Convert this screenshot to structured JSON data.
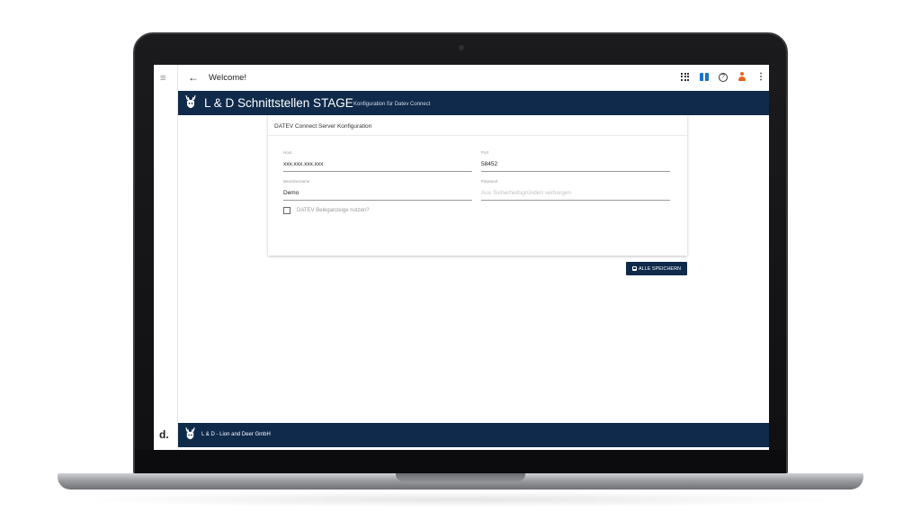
{
  "topbar": {
    "back_icon": "arrow-left-icon",
    "title": "Welcome!",
    "icons": [
      "apps-grid-icon",
      "gift-icon",
      "help-icon",
      "user-icon",
      "more-vert-icon"
    ]
  },
  "rail": {
    "menu_icon": "hamburger-menu-icon",
    "logo_text": "d."
  },
  "appbar": {
    "title": "L & D Schnittstellen STAGE",
    "subtitle": "Konfiguration für Datev Connect",
    "logo": "deer-logo-icon"
  },
  "card": {
    "title": "DATEV Connect Server Konfiguration",
    "host": {
      "label": "Host",
      "value": "xxx.xxx.xxx.xxx"
    },
    "port": {
      "label": "Port",
      "value": "58452"
    },
    "username": {
      "label": "Benutzername",
      "value": "Demo"
    },
    "password": {
      "label": "Passwort",
      "placeholder": "Aus Sicherheitsgründen verborgen"
    },
    "checkbox": {
      "label": "DATEV Beleganzeige nutzen?",
      "checked": false
    }
  },
  "actions": {
    "save_label": "ALLE SPEICHERN",
    "save_icon": "floppy-disk-icon"
  },
  "footer": {
    "text": "L & D - Lion and Deer GmbH"
  },
  "colors": {
    "primary": "#0f2a4a",
    "accent_user": "#e8641b",
    "accent_gift": "#1a73c9"
  }
}
